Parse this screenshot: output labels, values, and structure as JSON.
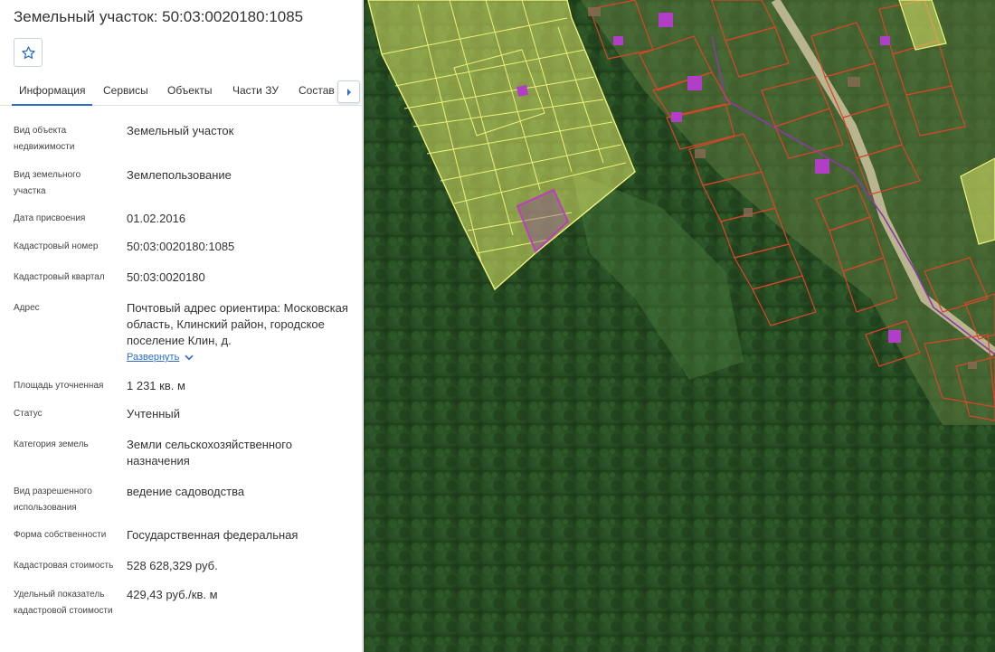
{
  "panel": {
    "title": "Земельный участок: 50:03:0020180:1085",
    "favorite_icon": "star-outline-icon",
    "tabs": [
      {
        "label": "Информация",
        "active": true
      },
      {
        "label": "Сервисы",
        "active": false
      },
      {
        "label": "Объекты",
        "active": false
      },
      {
        "label": "Части ЗУ",
        "active": false
      },
      {
        "label": "Состав Е",
        "active": false
      }
    ],
    "tabs_next_icon": "chevron-right-icon",
    "rows": [
      {
        "label": "Вид объекта недвижимости",
        "value": "Земельный участок"
      },
      {
        "label": "Вид земельного участка",
        "value": "Землепользование"
      },
      {
        "label": "Дата присвоения",
        "value": "01.02.2016"
      },
      {
        "label": "Кадастровый номер",
        "value": "50:03:0020180:1085"
      },
      {
        "label": "Кадастровый квартал",
        "value": "50:03:0020180"
      },
      {
        "label": "Адрес",
        "value": "Почтовый адрес ориентира: Московская область, Клинский район, городское поселение Клин, д."
      },
      {
        "label": "Площадь уточненная",
        "value": "1 231 кв. м"
      },
      {
        "label": "Статус",
        "value": "Учтенный"
      },
      {
        "label": "Категория земель",
        "value": "Земли сельскохозяйственного назначения"
      },
      {
        "label": "Вид разрешенного использования",
        "value": "ведение садоводства"
      },
      {
        "label": "Форма собственности",
        "value": "Государственная федеральная"
      },
      {
        "label": "Кадастровая стоимость",
        "value": "528 628,329 руб."
      },
      {
        "label": "Удельный показатель кадастровой стоимости",
        "value": "429,43 руб./кв. м"
      }
    ],
    "expand_label": "Развернуть",
    "expand_icon": "chevron-down-icon"
  },
  "colors": {
    "accent": "#2d6cc8",
    "selected_parcel": "#c03cc0",
    "yellow_parcels": "#e8ee70",
    "red_parcels": "#d8452a",
    "buildings": "#b23ec8"
  }
}
